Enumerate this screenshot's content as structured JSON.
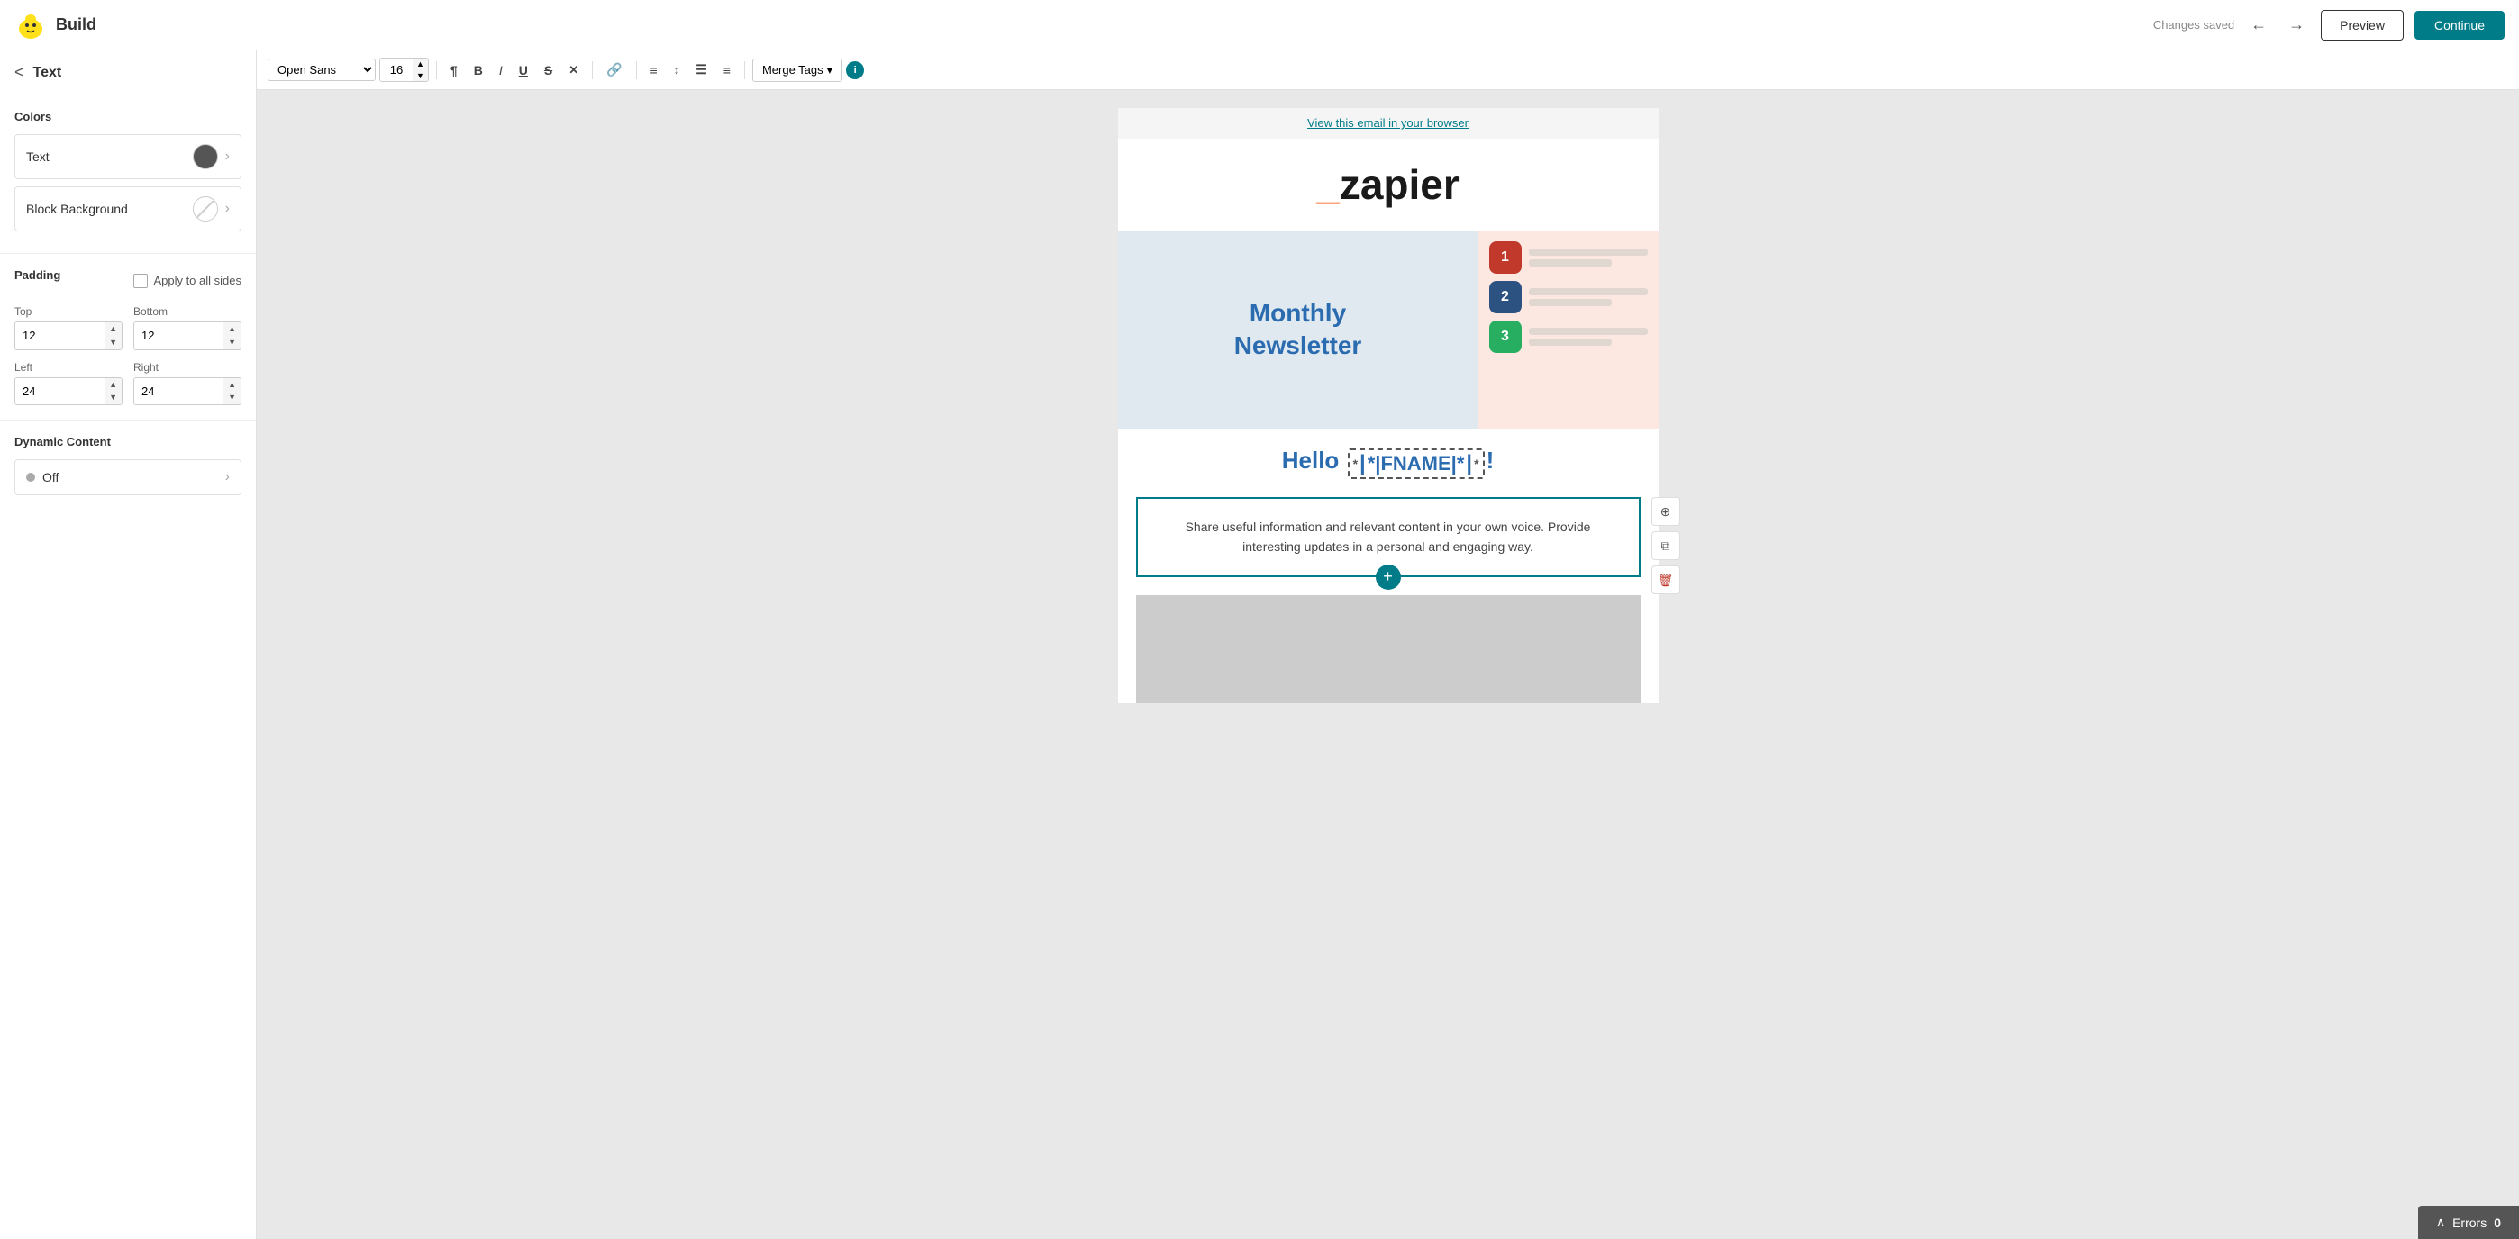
{
  "app": {
    "title": "Build",
    "changes_saved": "Changes saved"
  },
  "toolbar": {
    "font_family": "Open Sans",
    "font_size": "16",
    "merge_tags_label": "Merge Tags",
    "bold": "B",
    "italic": "I",
    "underline": "U",
    "strikethrough": "S",
    "clear": "✕"
  },
  "buttons": {
    "preview": "Preview",
    "continue": "Continue",
    "undo": "←",
    "redo": "→",
    "back": "<"
  },
  "sidebar": {
    "title": "Text",
    "colors_label": "Colors",
    "text_label": "Text",
    "block_background_label": "Block Background",
    "padding_label": "Padding",
    "apply_all_sides": "Apply to all sides",
    "top_label": "Top",
    "top_value": "12",
    "bottom_label": "Bottom",
    "bottom_value": "12",
    "left_label": "Left",
    "left_value": "24",
    "right_label": "Right",
    "right_value": "24",
    "dynamic_label": "Dynamic Content",
    "dynamic_value": "Off"
  },
  "email": {
    "view_browser": "View this email in your browser",
    "logo_text": "zapier",
    "newsletter_title": "Monthly\nNewsletter",
    "hello_text": "Hello",
    "fname_merge": "*|FNAME|*",
    "exclamation": "!",
    "body_text": "Share useful information and relevant content in your own voice. Provide interesting updates in a personal and engaging way.",
    "banner_numbers": [
      "1",
      "2",
      "3"
    ],
    "num_colors": [
      "#c0392b",
      "#2c5282",
      "#27ae60"
    ]
  },
  "errors": {
    "label": "Errors",
    "count": "0",
    "chevron": "∧"
  }
}
